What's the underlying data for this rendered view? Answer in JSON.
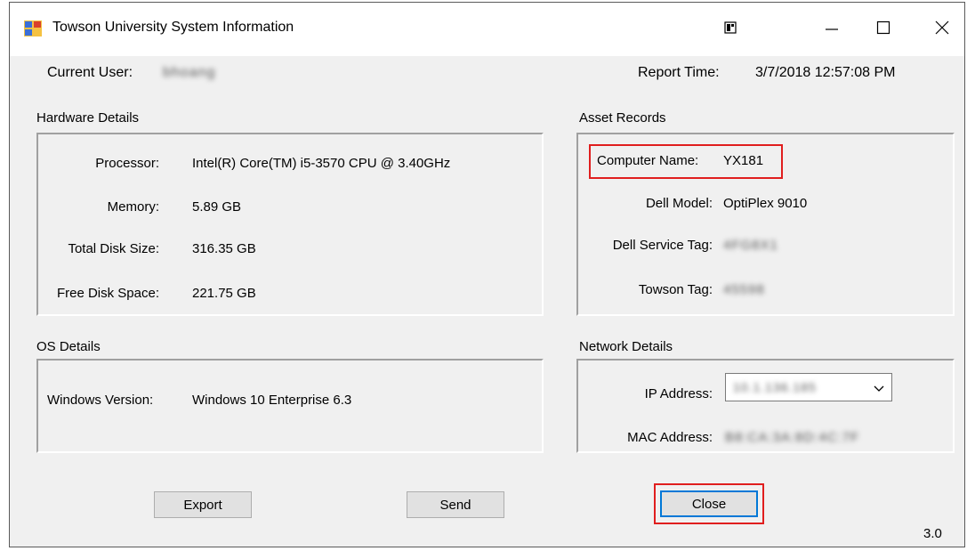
{
  "window": {
    "title": "Towson University System Information",
    "icons": {
      "app": "app-window-icon",
      "snap": "snap-layout-icon",
      "minimize": "minimize-icon",
      "maximize": "maximize-icon",
      "close": "close-icon"
    }
  },
  "header": {
    "current_user_label": "Current User:",
    "current_user_value": "bhoang",
    "report_time_label": "Report Time:",
    "report_time_value": "3/7/2018 12:57:08 PM"
  },
  "hardware": {
    "title": "Hardware Details",
    "rows": [
      {
        "label": "Processor:",
        "value": "Intel(R) Core(TM) i5-3570 CPU @ 3.40GHz"
      },
      {
        "label": "Memory:",
        "value": "5.89 GB"
      },
      {
        "label": "Total Disk Size:",
        "value": "316.35 GB"
      },
      {
        "label": "Free Disk Space:",
        "value": "221.75 GB"
      }
    ]
  },
  "os": {
    "title": "OS Details",
    "version_label": "Windows Version:",
    "version_value": "Windows 10 Enterprise  6.3"
  },
  "asset": {
    "title": "Asset Records",
    "computer_name_label": "Computer Name:",
    "computer_name_value": "YX181",
    "dell_model_label": "Dell Model:",
    "dell_model_value": "OptiPlex 9010",
    "service_tag_label": "Dell Service Tag:",
    "service_tag_value": "4FG8X1",
    "towson_tag_label": "Towson Tag:",
    "towson_tag_value": "45598"
  },
  "network": {
    "title": "Network Details",
    "ip_label": "IP Address:",
    "ip_value": "10.1.136.185",
    "mac_label": "MAC Address:",
    "mac_value": "B8:CA:3A:8D:4C:7F"
  },
  "buttons": {
    "export": "Export",
    "send": "Send",
    "close": "Close"
  },
  "version": "3.0",
  "colors": {
    "highlight": "#e01e1e",
    "focus": "#0078d7"
  }
}
